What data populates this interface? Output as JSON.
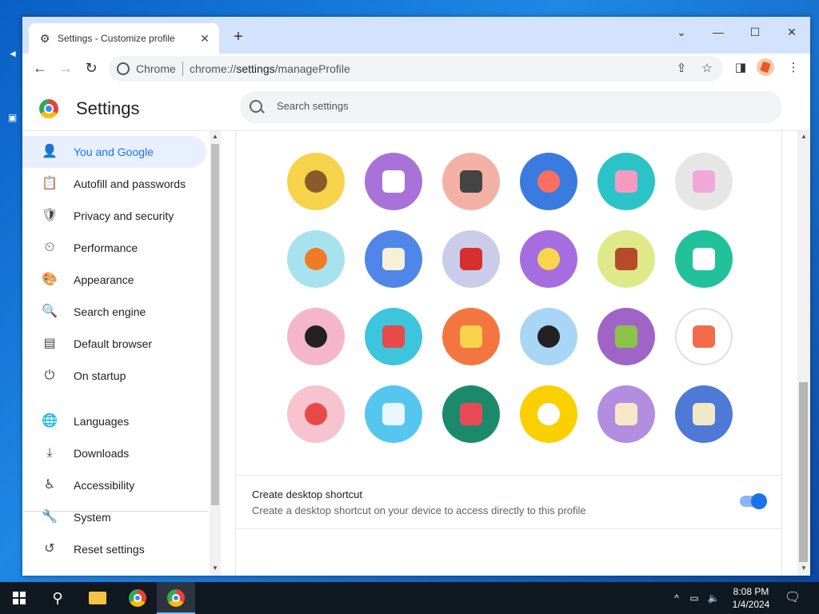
{
  "window": {
    "tab_title": "Settings - Customize profile",
    "new_tab_symbol": "+",
    "controls": {
      "dropdown": "⌄",
      "minimize": "—",
      "maximize": "☐",
      "close": "✕"
    }
  },
  "toolbar": {
    "omnibox_label": "Chrome",
    "url_prefix": "chrome://",
    "url_host": "settings",
    "url_path": "/manageProfile"
  },
  "header": {
    "title": "Settings",
    "search_placeholder": "Search settings"
  },
  "sidebar": {
    "items": [
      {
        "label": "You and Google",
        "icon": "person-icon",
        "glyph": "👤",
        "active": true
      },
      {
        "label": "Autofill and passwords",
        "icon": "clipboard-icon",
        "glyph": "📋"
      },
      {
        "label": "Privacy and security",
        "icon": "shield-icon",
        "glyph": "🛡"
      },
      {
        "label": "Performance",
        "icon": "speedometer-icon",
        "glyph": "⏲"
      },
      {
        "label": "Appearance",
        "icon": "palette-icon",
        "glyph": "🎨"
      },
      {
        "label": "Search engine",
        "icon": "search-icon",
        "glyph": "🔍"
      },
      {
        "label": "Default browser",
        "icon": "browser-icon",
        "glyph": "▤"
      },
      {
        "label": "On startup",
        "icon": "power-icon",
        "glyph": "⏻"
      },
      {
        "label": "Languages",
        "icon": "globe-icon",
        "glyph": "🌐"
      },
      {
        "label": "Downloads",
        "icon": "download-icon",
        "glyph": "⤓"
      },
      {
        "label": "Accessibility",
        "icon": "accessibility-icon",
        "glyph": "♿"
      },
      {
        "label": "System",
        "icon": "wrench-icon",
        "glyph": "🔧"
      },
      {
        "label": "Reset settings",
        "icon": "reset-icon",
        "glyph": "↺"
      }
    ]
  },
  "avatars": [
    {
      "name": "monkey",
      "bg": "#f7d24b",
      "fg": "#8a5a2b"
    },
    {
      "name": "panda",
      "bg": "#a972d9",
      "fg": "#ffffff"
    },
    {
      "name": "penguin",
      "bg": "#f3b1a6",
      "fg": "#444444"
    },
    {
      "name": "butterfly",
      "bg": "#3a7be0",
      "fg": "#ff6f61"
    },
    {
      "name": "rabbit",
      "bg": "#2cc3c8",
      "fg": "#f49ac1"
    },
    {
      "name": "unicorn",
      "bg": "#e6e6e6",
      "fg": "#f0a8d8"
    },
    {
      "name": "basketball",
      "bg": "#a7e3ee",
      "fg": "#f07b26"
    },
    {
      "name": "bike",
      "bg": "#4f86e7",
      "fg": "#f6f0d8"
    },
    {
      "name": "bird",
      "bg": "#c9cde9",
      "fg": "#d72f2f"
    },
    {
      "name": "cheese",
      "bg": "#a66de0",
      "fg": "#f7d54d"
    },
    {
      "name": "football",
      "bg": "#dfe98a",
      "fg": "#b64a2a"
    },
    {
      "name": "sushi-plate",
      "bg": "#21c29b",
      "fg": "#ffffff"
    },
    {
      "name": "sunglasses",
      "bg": "#f5b6cc",
      "fg": "#222222"
    },
    {
      "name": "sushi",
      "bg": "#3cc5dc",
      "fg": "#e84a4a"
    },
    {
      "name": "tamagotchi",
      "bg": "#f37640",
      "fg": "#f7d24b"
    },
    {
      "name": "vinyl",
      "bg": "#a9d6f5",
      "fg": "#222222"
    },
    {
      "name": "avocado",
      "bg": "#a064c7",
      "fg": "#8bc34a"
    },
    {
      "name": "smile",
      "bg": "#ffffff",
      "fg": "#f26b4b"
    },
    {
      "name": "ice-cream",
      "bg": "#f7c3cf",
      "fg": "#e84a4a"
    },
    {
      "name": "popsicle",
      "bg": "#55c6ee",
      "fg": "#e8f7ff"
    },
    {
      "name": "watermelon",
      "bg": "#1b8a6b",
      "fg": "#ea4a57"
    },
    {
      "name": "onigiri",
      "bg": "#fbd000",
      "fg": "#ffffff"
    },
    {
      "name": "pizza",
      "bg": "#b38de0",
      "fg": "#f7e7c8"
    },
    {
      "name": "sandwich",
      "bg": "#4e79d6",
      "fg": "#f1e8c8"
    }
  ],
  "shortcut": {
    "title": "Create desktop shortcut",
    "description": "Create a desktop shortcut on your device to access directly to this profile",
    "enabled": true
  },
  "taskbar": {
    "time": "8:08 PM",
    "date": "1/4/2024"
  },
  "colors": {
    "accent": "#1a73e8",
    "active_nav_bg": "#e8f0fe",
    "titlebar": "#d3e3fd"
  }
}
